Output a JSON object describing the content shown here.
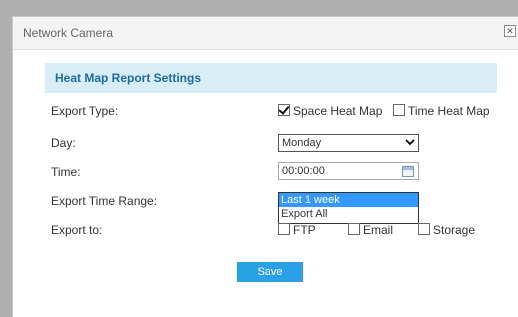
{
  "window": {
    "title": "Network Camera",
    "close_symbol": "✕"
  },
  "section": {
    "title": "Heat Map Report Settings"
  },
  "form": {
    "export_type": {
      "label": "Export Type:",
      "options": [
        {
          "label": "Space Heat Map",
          "checked": true
        },
        {
          "label": "Time Heat Map",
          "checked": false
        }
      ]
    },
    "day": {
      "label": "Day:",
      "value": "Monday"
    },
    "time": {
      "label": "Time:",
      "value": "00:00:00"
    },
    "export_time_range": {
      "label": "Export Time Range:",
      "options": [
        "Last 1 week",
        "Export All"
      ],
      "selected": "Last 1 week"
    },
    "export_to": {
      "label": "Export to:",
      "options": [
        {
          "label": "FTP",
          "checked": false
        },
        {
          "label": "Email",
          "checked": false
        },
        {
          "label": "Storage",
          "checked": false
        }
      ]
    }
  },
  "actions": {
    "save_label": "Save"
  },
  "colors": {
    "accent": "#2aa0e6",
    "header_bg": "#d9edf7",
    "header_text": "#1c6ca3",
    "selection": "#3399ff"
  }
}
